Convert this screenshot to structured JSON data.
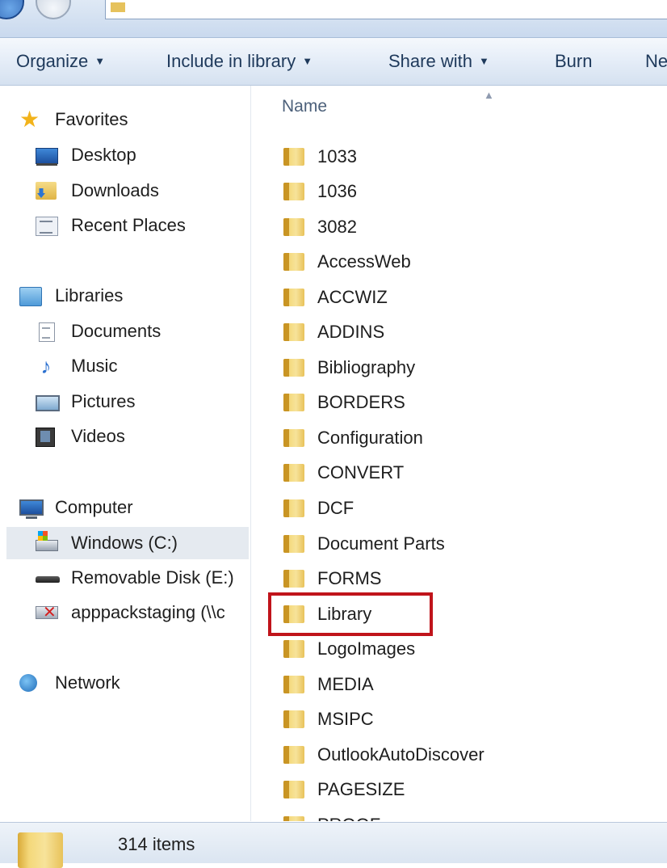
{
  "toolbar": {
    "organize": "Organize",
    "include_in_library": "Include in library",
    "share_with": "Share with",
    "burn": "Burn",
    "new_folder_partial": "Ne"
  },
  "nav": {
    "favorites": {
      "header": "Favorites",
      "items": [
        "Desktop",
        "Downloads",
        "Recent Places"
      ]
    },
    "libraries": {
      "header": "Libraries",
      "items": [
        "Documents",
        "Music",
        "Pictures",
        "Videos"
      ]
    },
    "computer": {
      "header": "Computer",
      "items": [
        "Windows (C:)",
        "Removable Disk (E:)",
        "apppackstaging (\\\\c"
      ]
    },
    "network": {
      "header": "Network"
    },
    "selected_item": "Windows (C:)"
  },
  "filelist": {
    "column_header": "Name",
    "items": [
      "1033",
      "1036",
      "3082",
      "AccessWeb",
      "ACCWIZ",
      "ADDINS",
      "Bibliography",
      "BORDERS",
      "Configuration",
      "CONVERT",
      "DCF",
      "Document Parts",
      "FORMS",
      "Library",
      "LogoImages",
      "MEDIA",
      "MSIPC",
      "OutlookAutoDiscover",
      "PAGESIZE",
      "PROOF"
    ],
    "highlighted_item": "Library",
    "highlight_color": "#c0141b"
  },
  "status": {
    "item_count": "314 items"
  },
  "colors": {
    "commandbar_text": "#1e395b",
    "folder_yellow": "#f4d87a",
    "selection_bg": "#e5eaf0"
  }
}
